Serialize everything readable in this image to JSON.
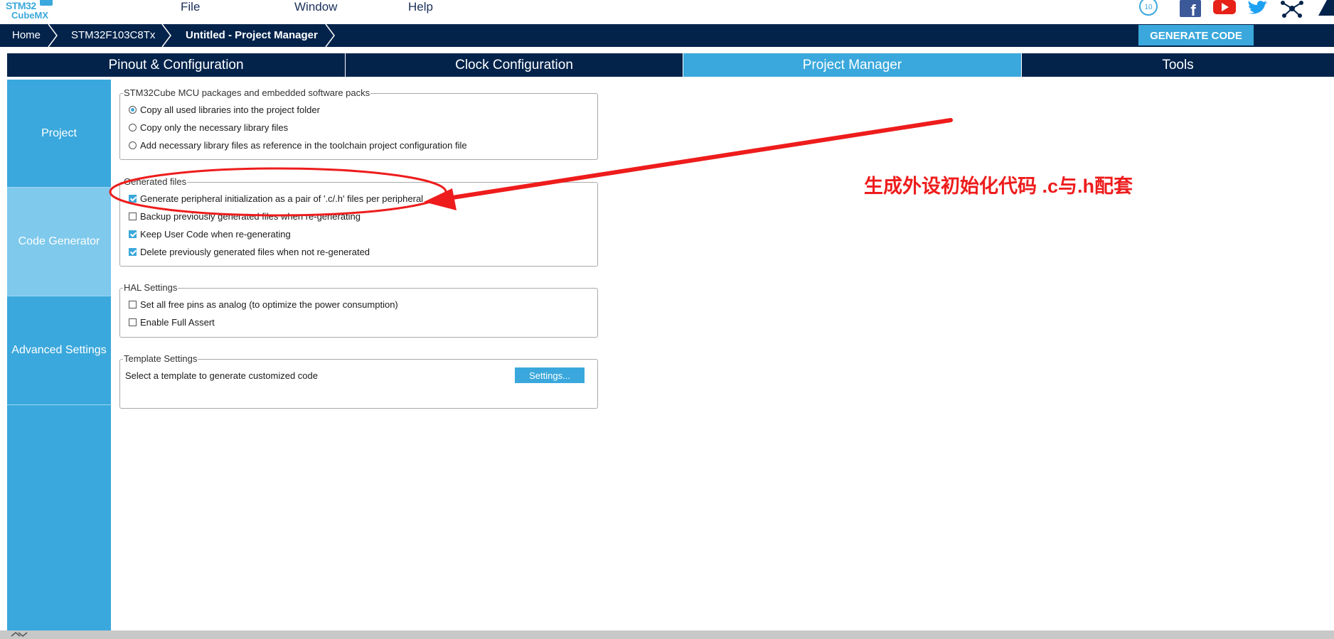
{
  "app": {
    "logo_line1": "STM32",
    "logo_line2": "CubeMX"
  },
  "menu": [
    "File",
    "Window",
    "Help"
  ],
  "social_icons": [
    "anniversary-badge-icon",
    "facebook-icon",
    "youtube-icon",
    "twitter-icon",
    "network-icon",
    "st-logo-icon"
  ],
  "breadcrumb": [
    "Home",
    "STM32F103C8Tx",
    "Untitled - Project Manager"
  ],
  "generate_button": "GENERATE CODE",
  "tabs": [
    "Pinout & Configuration",
    "Clock Configuration",
    "Project Manager",
    "Tools"
  ],
  "active_tab": "Project Manager",
  "sidenav": [
    "Project",
    "Code Generator",
    "Advanced Settings"
  ],
  "active_side": "Code Generator",
  "groups": {
    "packages": {
      "title": "STM32Cube MCU packages and embedded software packs",
      "options": [
        {
          "label": "Copy all used libraries into the project folder",
          "selected": true
        },
        {
          "label": "Copy only the necessary library files",
          "selected": false
        },
        {
          "label": "Add necessary library files as reference in the toolchain project configuration file",
          "selected": false
        }
      ]
    },
    "generated": {
      "title": "Generated files",
      "options": [
        {
          "label": "Generate peripheral initialization as a pair of '.c/.h' files per peripheral",
          "checked": true
        },
        {
          "label": "Backup previously generated files when re-generating",
          "checked": false
        },
        {
          "label": "Keep User Code when re-generating",
          "checked": true
        },
        {
          "label": "Delete previously generated files when not re-generated",
          "checked": true
        }
      ]
    },
    "hal": {
      "title": "HAL Settings",
      "options": [
        {
          "label": "Set all free pins as analog (to optimize the power consumption)",
          "checked": false
        },
        {
          "label": "Enable Full Assert",
          "checked": false
        }
      ]
    },
    "template": {
      "title": "Template Settings",
      "text": "Select a template to generate customized code",
      "button": "Settings..."
    }
  },
  "annotation": "生成外设初始化代码  .c与.h配套",
  "colors": {
    "navy": "#03234b",
    "accent": "#3aa8dc",
    "active_side": "#7ec9ec",
    "annotation": "#ee1c1c"
  }
}
